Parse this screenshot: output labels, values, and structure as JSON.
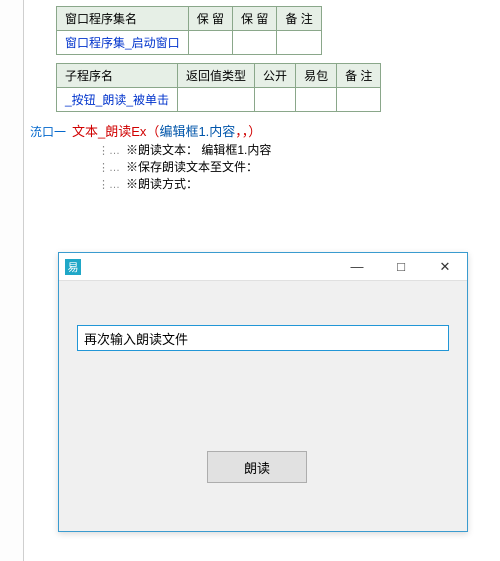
{
  "tables": {
    "windowProgram": {
      "headers": [
        "窗口程序集名",
        "保 留",
        "保 留",
        "备 注"
      ],
      "row": [
        "窗口程序集_启动窗口",
        "",
        "",
        ""
      ]
    },
    "subProgram": {
      "headers": [
        "子程序名",
        "返回值类型",
        "公开",
        "易包",
        "备 注"
      ],
      "row": [
        "_按钮_朗读_被单击",
        "",
        "",
        "",
        ""
      ]
    }
  },
  "code": {
    "marker": "㳘口一",
    "func": "文本_朗读Ex",
    "arg1": "编辑框1.内容",
    "paren_open": "（",
    "paren_close": "，，）",
    "params": [
      "※朗读文本：  编辑框1.内容",
      "※保存朗读文本至文件：",
      "※朗读方式："
    ],
    "tree_prefix": "⋮…"
  },
  "appWindow": {
    "iconLetter": "易",
    "title": "",
    "minimize": "—",
    "maximize": "□",
    "close": "✕",
    "textboxValue": "再次输入朗读文件",
    "readButton": "朗读"
  }
}
